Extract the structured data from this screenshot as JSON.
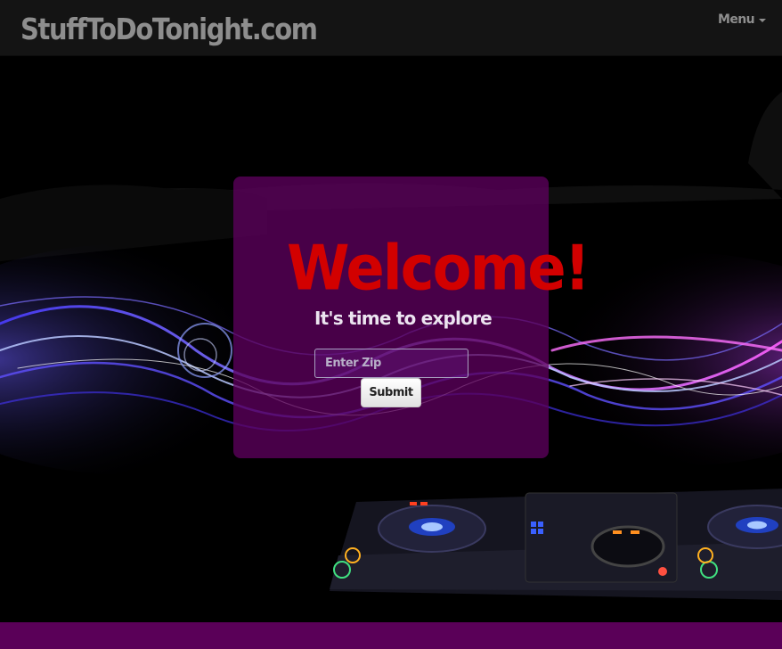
{
  "navbar": {
    "brand": "StuffToDoTonight.com",
    "menu_label": "Menu",
    "menu_icon": "caret-down-icon"
  },
  "hero": {
    "welcome_title": "Welcome!",
    "tagline": "It's time to explore",
    "zip_placeholder": "Enter Zip",
    "zip_value": "",
    "submit_label": "Submit"
  },
  "colors": {
    "navbar_bg": "#141414",
    "brand_text": "#8e8e8e",
    "panel_bg": "#5c005c",
    "welcome_text": "#d20000",
    "footer_bg": "#5a0058"
  }
}
